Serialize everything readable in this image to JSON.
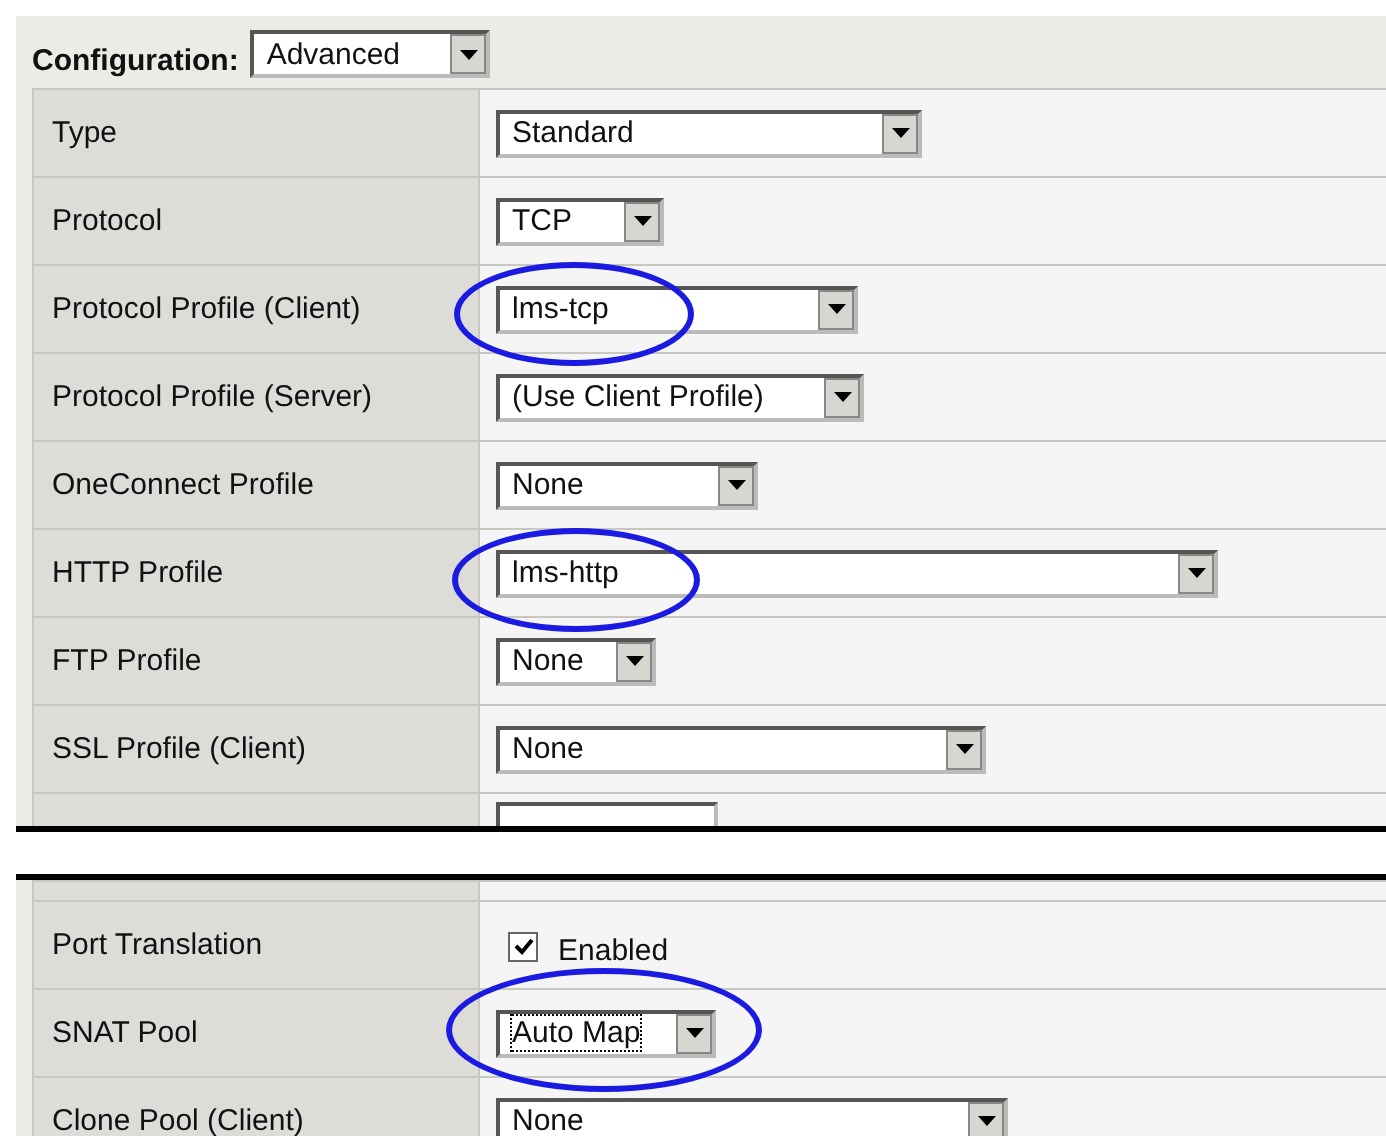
{
  "configuration": {
    "label": "Configuration:",
    "value": "Advanced"
  },
  "sections": [
    {
      "rows": [
        {
          "label": "Type",
          "kind": "select",
          "value": "Standard",
          "highlighted": false
        },
        {
          "label": "Protocol",
          "kind": "select",
          "value": "TCP",
          "highlighted": false
        },
        {
          "label": "Protocol Profile (Client)",
          "kind": "select",
          "value": "lms-tcp",
          "highlighted": true
        },
        {
          "label": "Protocol Profile (Server)",
          "kind": "select",
          "value": "(Use Client Profile)",
          "highlighted": false
        },
        {
          "label": "OneConnect Profile",
          "kind": "select",
          "value": "None",
          "highlighted": false
        },
        {
          "label": "HTTP Profile",
          "kind": "select",
          "value": "lms-http",
          "highlighted": true
        },
        {
          "label": "FTP Profile",
          "kind": "select",
          "value": "None",
          "highlighted": false
        },
        {
          "label": "SSL Profile (Client)",
          "kind": "select",
          "value": "None",
          "highlighted": false
        }
      ]
    },
    {
      "rows": [
        {
          "label": "Port Translation",
          "kind": "checkbox",
          "value": "Enabled",
          "checked": true,
          "highlighted": false
        },
        {
          "label": "SNAT Pool",
          "kind": "select",
          "value": "Auto Map",
          "highlighted": true
        },
        {
          "label": "Clone Pool (Client)",
          "kind": "select",
          "value": "None",
          "highlighted": false
        }
      ]
    }
  ]
}
